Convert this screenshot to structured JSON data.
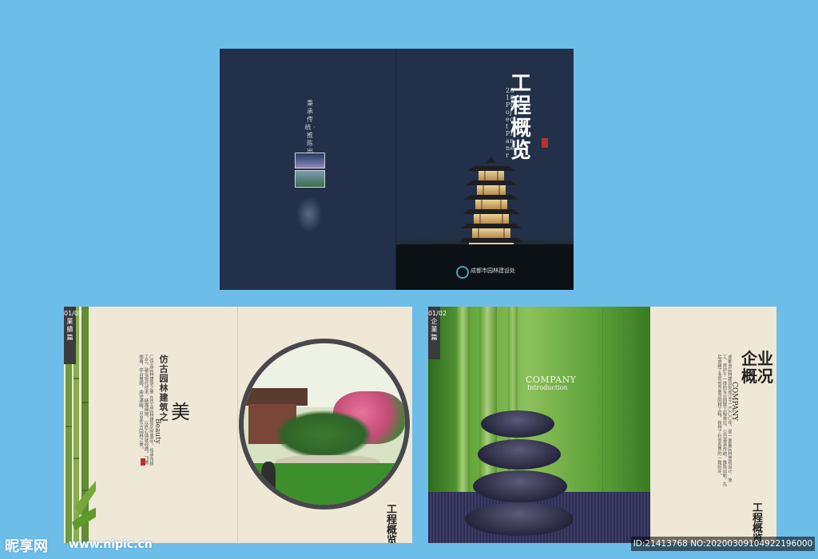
{
  "background_color": "#6dbde9",
  "cover": {
    "bg_color": "#233049",
    "spine_text": "秉承传统 · 推陈出新",
    "title": "工程概览",
    "subtitle_en": "2018 Project Planner",
    "company": "成都市园林建设处"
  },
  "page_left": {
    "tab": "01/02 業績篇",
    "heading": "仿古园林建筑之",
    "big_char": "美",
    "beauty_en": "Beauty",
    "body": "〇仿古园林建筑之美 在仿古园林建筑的营造中，传承传统工艺，融合现代技术，精雕细琢，以匠心铸就经典。飞檐翘角，亭台楼阁，曲径通幽，尽显东方园林之美。",
    "logo": "工程概览"
  },
  "page_right": {
    "tab": "01/02 企業篇",
    "company_en": "COMPANY",
    "introduction": "Introduction",
    "title": "企业概况",
    "title_en": "COMPANY",
    "body": "成都市园林建设处成立于二〇〇〇年，是一家集园林景观设计、施工、养护于一体的专业园林工程单位。公司秉承传统，推陈出新，先后承建了多项省市重点园林工程，获得了社会各界的一致好评。",
    "logo": "工程概览"
  },
  "watermark": {
    "brand": "昵享网",
    "url": "www.nipic.cn",
    "id_text": "ID:21413768 NO:20200309104922196000"
  }
}
